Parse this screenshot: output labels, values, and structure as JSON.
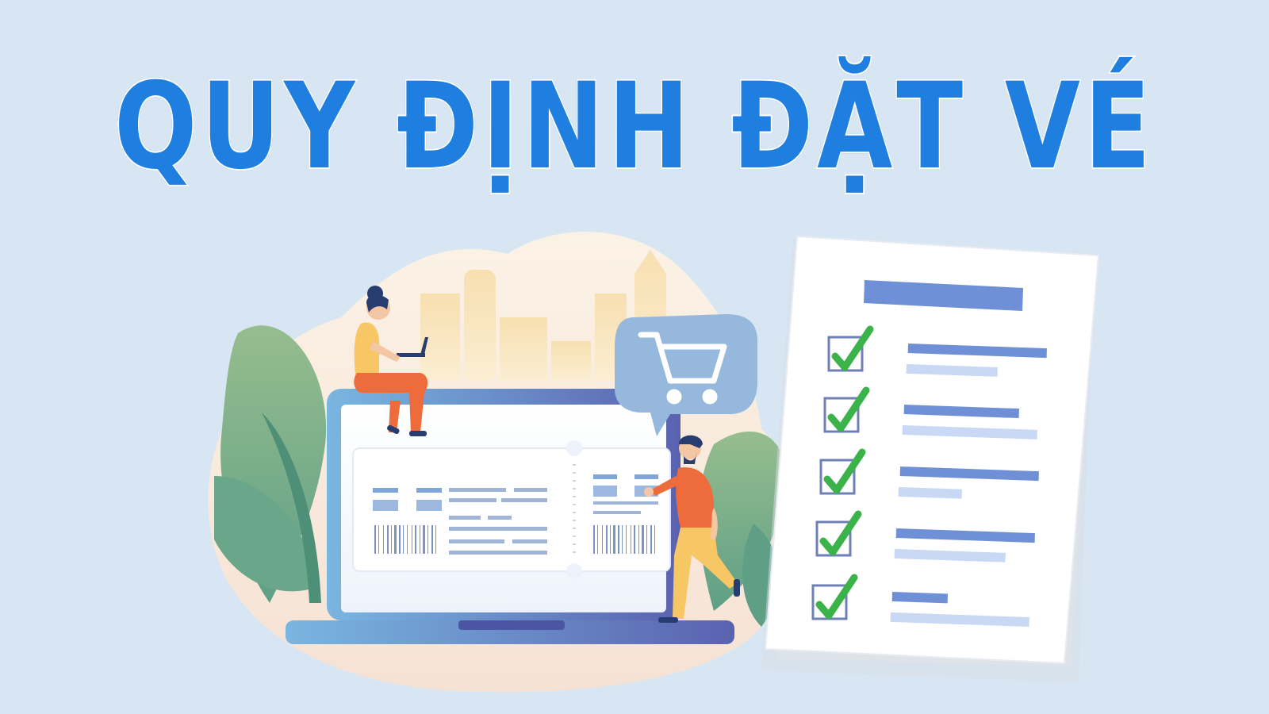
{
  "title": "QUY ĐỊNH ĐẶT VÉ",
  "illustration": {
    "icons": [
      "cart-icon",
      "barcode-icon",
      "checkmark-icon"
    ],
    "checklist_items_count_visible": 5
  },
  "colors": {
    "background": "#d7e6f2",
    "title_top": "#2a63d6",
    "title_bottom": "#1a8cf2",
    "check": "#3bb34a",
    "checklist_bar": "#6f8fd6",
    "checklist_bar_light": "#c9d9f5",
    "laptop_frame": "#6a95d0",
    "leaf_green": "#7db58c"
  }
}
